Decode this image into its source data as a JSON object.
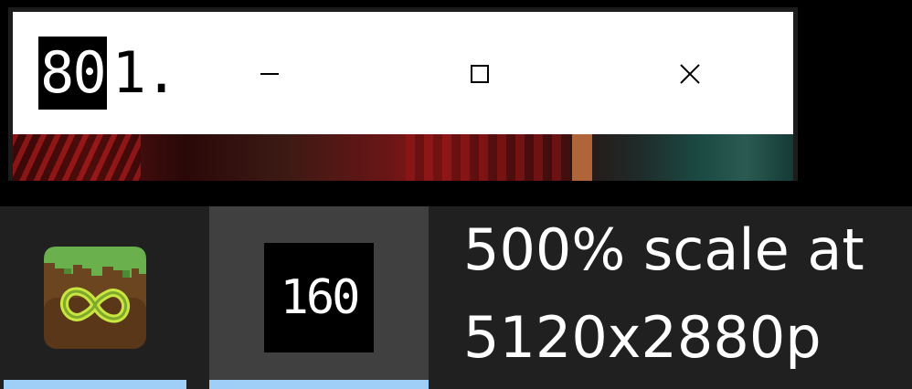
{
  "window": {
    "title_highlighted": "80",
    "title_rest": "1.",
    "minimize_icon": "minimize-icon",
    "maximize_icon": "maximize-icon",
    "close_icon": "close-icon"
  },
  "taskbar": {
    "app_icon": "minecraft-launcher-infinity-icon",
    "scale_badge": "160",
    "active_indicator_color": "#9fcff7"
  },
  "caption": {
    "line1": "500% scale at",
    "line2": "5120x2880p"
  }
}
